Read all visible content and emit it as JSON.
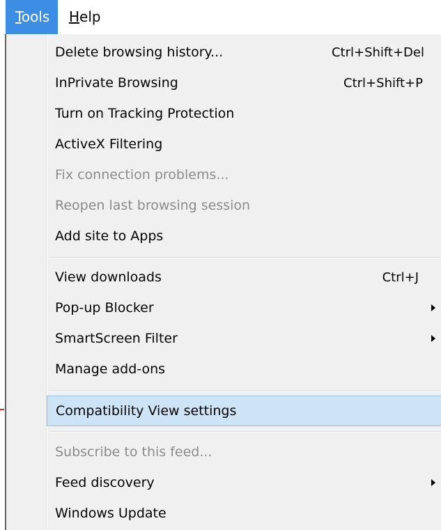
{
  "menubar": {
    "tools_label": "Tools",
    "tools_mnemonic": "T",
    "tools_rest": "ools",
    "help_label": "Help",
    "help_mnemonic": "H",
    "help_rest": "elp"
  },
  "colors": {
    "active_menu": "#3c8ee4",
    "highlight_fill": "#cde3f6",
    "highlight_border": "#8fbfea",
    "disabled_text": "#8b8b8b",
    "menu_background": "#f0f0f0"
  },
  "menu": {
    "items": [
      {
        "label": "Delete browsing history...",
        "shortcut": "Ctrl+Shift+Del",
        "enabled": true
      },
      {
        "label": "InPrivate Browsing",
        "shortcut": "Ctrl+Shift+P",
        "enabled": true
      },
      {
        "label": "Turn on Tracking Protection",
        "enabled": true
      },
      {
        "label": "ActiveX Filtering",
        "enabled": true
      },
      {
        "label": "Fix connection problems...",
        "enabled": false
      },
      {
        "label": "Reopen last browsing session",
        "enabled": false
      },
      {
        "label": "Add site to Apps",
        "enabled": true
      },
      {
        "label": "View downloads",
        "shortcut": "Ctrl+J",
        "enabled": true
      },
      {
        "label": "Pop-up Blocker",
        "submenu": true,
        "enabled": true
      },
      {
        "label": "SmartScreen Filter",
        "submenu": true,
        "enabled": true
      },
      {
        "label": "Manage add-ons",
        "enabled": true
      },
      {
        "label": "Compatibility View settings",
        "enabled": true,
        "highlighted": true
      },
      {
        "label": "Subscribe to this feed...",
        "enabled": false
      },
      {
        "label": "Feed discovery",
        "submenu": true,
        "enabled": true
      },
      {
        "label": "Windows Update",
        "enabled": true
      }
    ]
  }
}
